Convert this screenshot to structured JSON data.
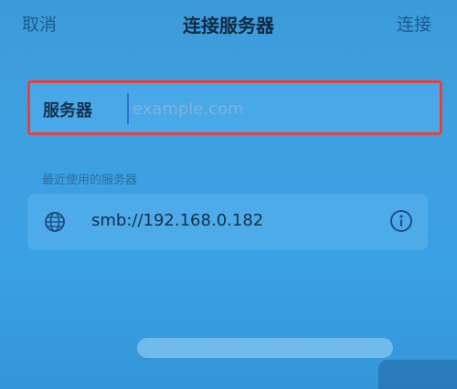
{
  "navbar": {
    "cancel_label": "取消",
    "title": "连接服务器",
    "connect_label": "连接"
  },
  "server_field": {
    "label": "服务器",
    "placeholder": "example.com",
    "value": ""
  },
  "recent": {
    "header": "最近使用的服务器",
    "items": [
      {
        "address": "smb://192.168.0.182",
        "icon": "globe-icon",
        "action_icon": "info-icon"
      }
    ]
  },
  "colors": {
    "background": "#3fa0e0",
    "highlight_border": "#e8403a",
    "accent": "#1d5b93"
  }
}
